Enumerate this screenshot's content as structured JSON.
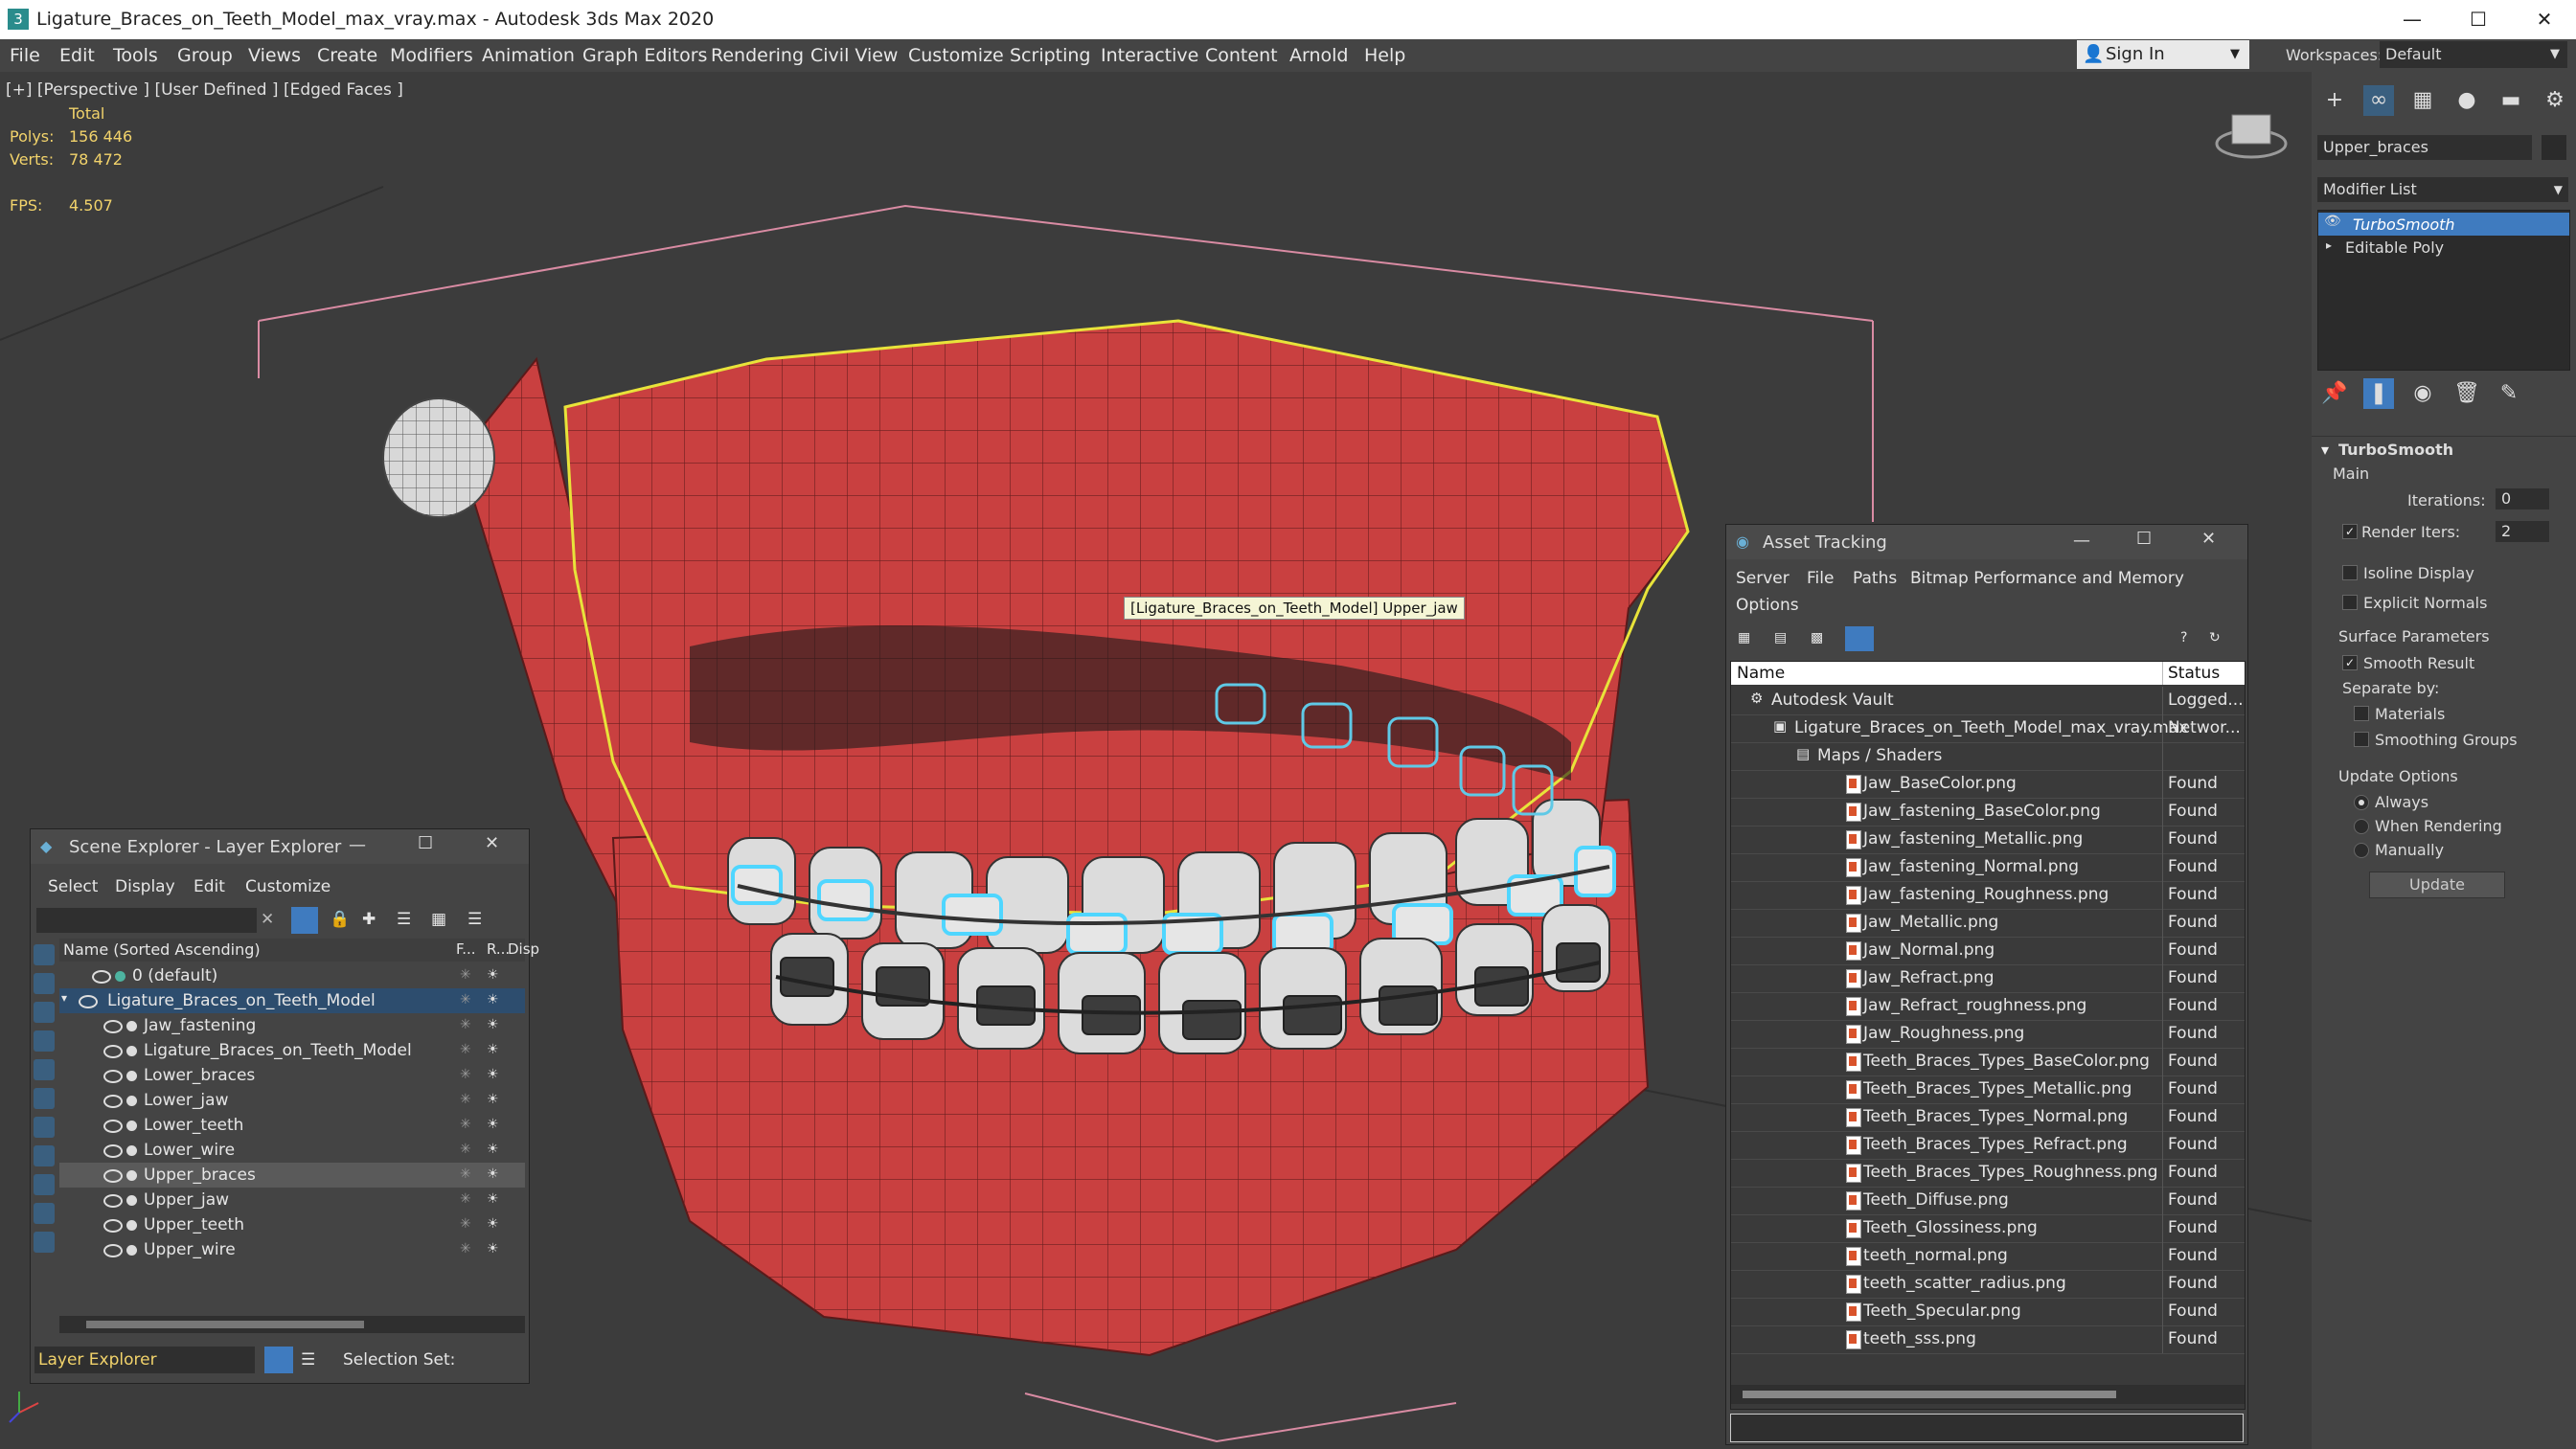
{
  "window": {
    "title": "Ligature_Braces_on_Teeth_Model_max_vray.max - Autodesk 3ds Max 2020",
    "min_glyph": "—",
    "max_glyph": "☐",
    "close_glyph": "✕"
  },
  "menu": {
    "items": [
      "File",
      "Edit",
      "Tools",
      "Group",
      "Views",
      "Create",
      "Modifiers",
      "Animation",
      "Graph Editors",
      "Rendering",
      "Civil View",
      "Customize",
      "Scripting",
      "Interactive",
      "Content",
      "Arnold",
      "Help"
    ],
    "sign_in": "Sign In",
    "workspaces_label": "Workspaces:",
    "workspace_value": "Default"
  },
  "viewport": {
    "label": "[+] [Perspective ] [User Defined ] [Edged Faces ]",
    "stats": {
      "total_label": "Total",
      "polys_label": "Polys:",
      "polys_value": "156 446",
      "verts_label": "Verts:",
      "verts_value": "78 472",
      "fps_label": "FPS:",
      "fps_value": "4.507"
    },
    "tooltip": "[Ligature_Braces_on_Teeth_Model] Upper_jaw"
  },
  "command_panel": {
    "object_name": "Upper_braces",
    "modifier_list_label": "Modifier List",
    "stack": [
      "TurboSmooth",
      "Editable Poly"
    ],
    "rollout_title": "TurboSmooth",
    "main_label": "Main",
    "iterations_label": "Iterations:",
    "iterations_value": "0",
    "render_iters_label": "Render Iters:",
    "render_iters_value": "2",
    "isoline_label": "Isoline Display",
    "explicit_normals_label": "Explicit Normals",
    "surface_params_label": "Surface Parameters",
    "smooth_result_label": "Smooth Result",
    "separate_by_label": "Separate by:",
    "materials_label": "Materials",
    "smoothing_groups_label": "Smoothing Groups",
    "update_options_label": "Update Options",
    "always_label": "Always",
    "when_rendering_label": "When Rendering",
    "manually_label": "Manually",
    "update_button": "Update"
  },
  "scene_explorer": {
    "title": "Scene Explorer - Layer Explorer",
    "menu": [
      "Select",
      "Display",
      "Edit",
      "Customize"
    ],
    "col_name": "Name (Sorted Ascending)",
    "col_f": "F...",
    "col_r": "R...",
    "col_disp": "Disp",
    "rows": [
      {
        "label": "0 (default)",
        "level": 1
      },
      {
        "label": "Ligature_Braces_on_Teeth_Model",
        "level": 0
      },
      {
        "label": "Jaw_fastening",
        "level": 2
      },
      {
        "label": "Ligature_Braces_on_Teeth_Model",
        "level": 2
      },
      {
        "label": "Lower_braces",
        "level": 2
      },
      {
        "label": "Lower_jaw",
        "level": 2
      },
      {
        "label": "Lower_teeth",
        "level": 2
      },
      {
        "label": "Lower_wire",
        "level": 2
      },
      {
        "label": "Upper_braces",
        "level": 2
      },
      {
        "label": "Upper_jaw",
        "level": 2
      },
      {
        "label": "Upper_teeth",
        "level": 2
      },
      {
        "label": "Upper_wire",
        "level": 2
      }
    ],
    "footer_label": "Layer Explorer",
    "selection_set_label": "Selection Set:"
  },
  "asset_tracking": {
    "title": "Asset Tracking",
    "menu": [
      "Server",
      "File",
      "Paths",
      "Bitmap Performance and Memory"
    ],
    "options_label": "Options",
    "col_name": "Name",
    "col_status": "Status",
    "rows": [
      {
        "name": "Autodesk Vault",
        "status": "Logged...",
        "level": 0
      },
      {
        "name": "Ligature_Braces_on_Teeth_Model_max_vray.max",
        "status": "Networ...",
        "level": 1
      },
      {
        "name": "Maps / Shaders",
        "status": "",
        "level": 2
      },
      {
        "name": "Jaw_BaseColor.png",
        "status": "Found",
        "level": 3
      },
      {
        "name": "Jaw_fastening_BaseColor.png",
        "status": "Found",
        "level": 3
      },
      {
        "name": "Jaw_fastening_Metallic.png",
        "status": "Found",
        "level": 3
      },
      {
        "name": "Jaw_fastening_Normal.png",
        "status": "Found",
        "level": 3
      },
      {
        "name": "Jaw_fastening_Roughness.png",
        "status": "Found",
        "level": 3
      },
      {
        "name": "Jaw_Metallic.png",
        "status": "Found",
        "level": 3
      },
      {
        "name": "Jaw_Normal.png",
        "status": "Found",
        "level": 3
      },
      {
        "name": "Jaw_Refract.png",
        "status": "Found",
        "level": 3
      },
      {
        "name": "Jaw_Refract_roughness.png",
        "status": "Found",
        "level": 3
      },
      {
        "name": "Jaw_Roughness.png",
        "status": "Found",
        "level": 3
      },
      {
        "name": "Teeth_Braces_Types_BaseColor.png",
        "status": "Found",
        "level": 3
      },
      {
        "name": "Teeth_Braces_Types_Metallic.png",
        "status": "Found",
        "level": 3
      },
      {
        "name": "Teeth_Braces_Types_Normal.png",
        "status": "Found",
        "level": 3
      },
      {
        "name": "Teeth_Braces_Types_Refract.png",
        "status": "Found",
        "level": 3
      },
      {
        "name": "Teeth_Braces_Types_Roughness.png",
        "status": "Found",
        "level": 3
      },
      {
        "name": "Teeth_Diffuse.png",
        "status": "Found",
        "level": 3
      },
      {
        "name": "Teeth_Glossiness.png",
        "status": "Found",
        "level": 3
      },
      {
        "name": "teeth_normal.png",
        "status": "Found",
        "level": 3
      },
      {
        "name": "teeth_scatter_radius.png",
        "status": "Found",
        "level": 3
      },
      {
        "name": "Teeth_Specular.png",
        "status": "Found",
        "level": 3
      },
      {
        "name": "teeth_sss.png",
        "status": "Found",
        "level": 3
      }
    ]
  },
  "colors": {
    "selection_yellow": "#e8e33a",
    "jaw_red": "#c94040",
    "highlight_blue": "#3f7bbf",
    "stat_yellow": "#f2d36b"
  }
}
